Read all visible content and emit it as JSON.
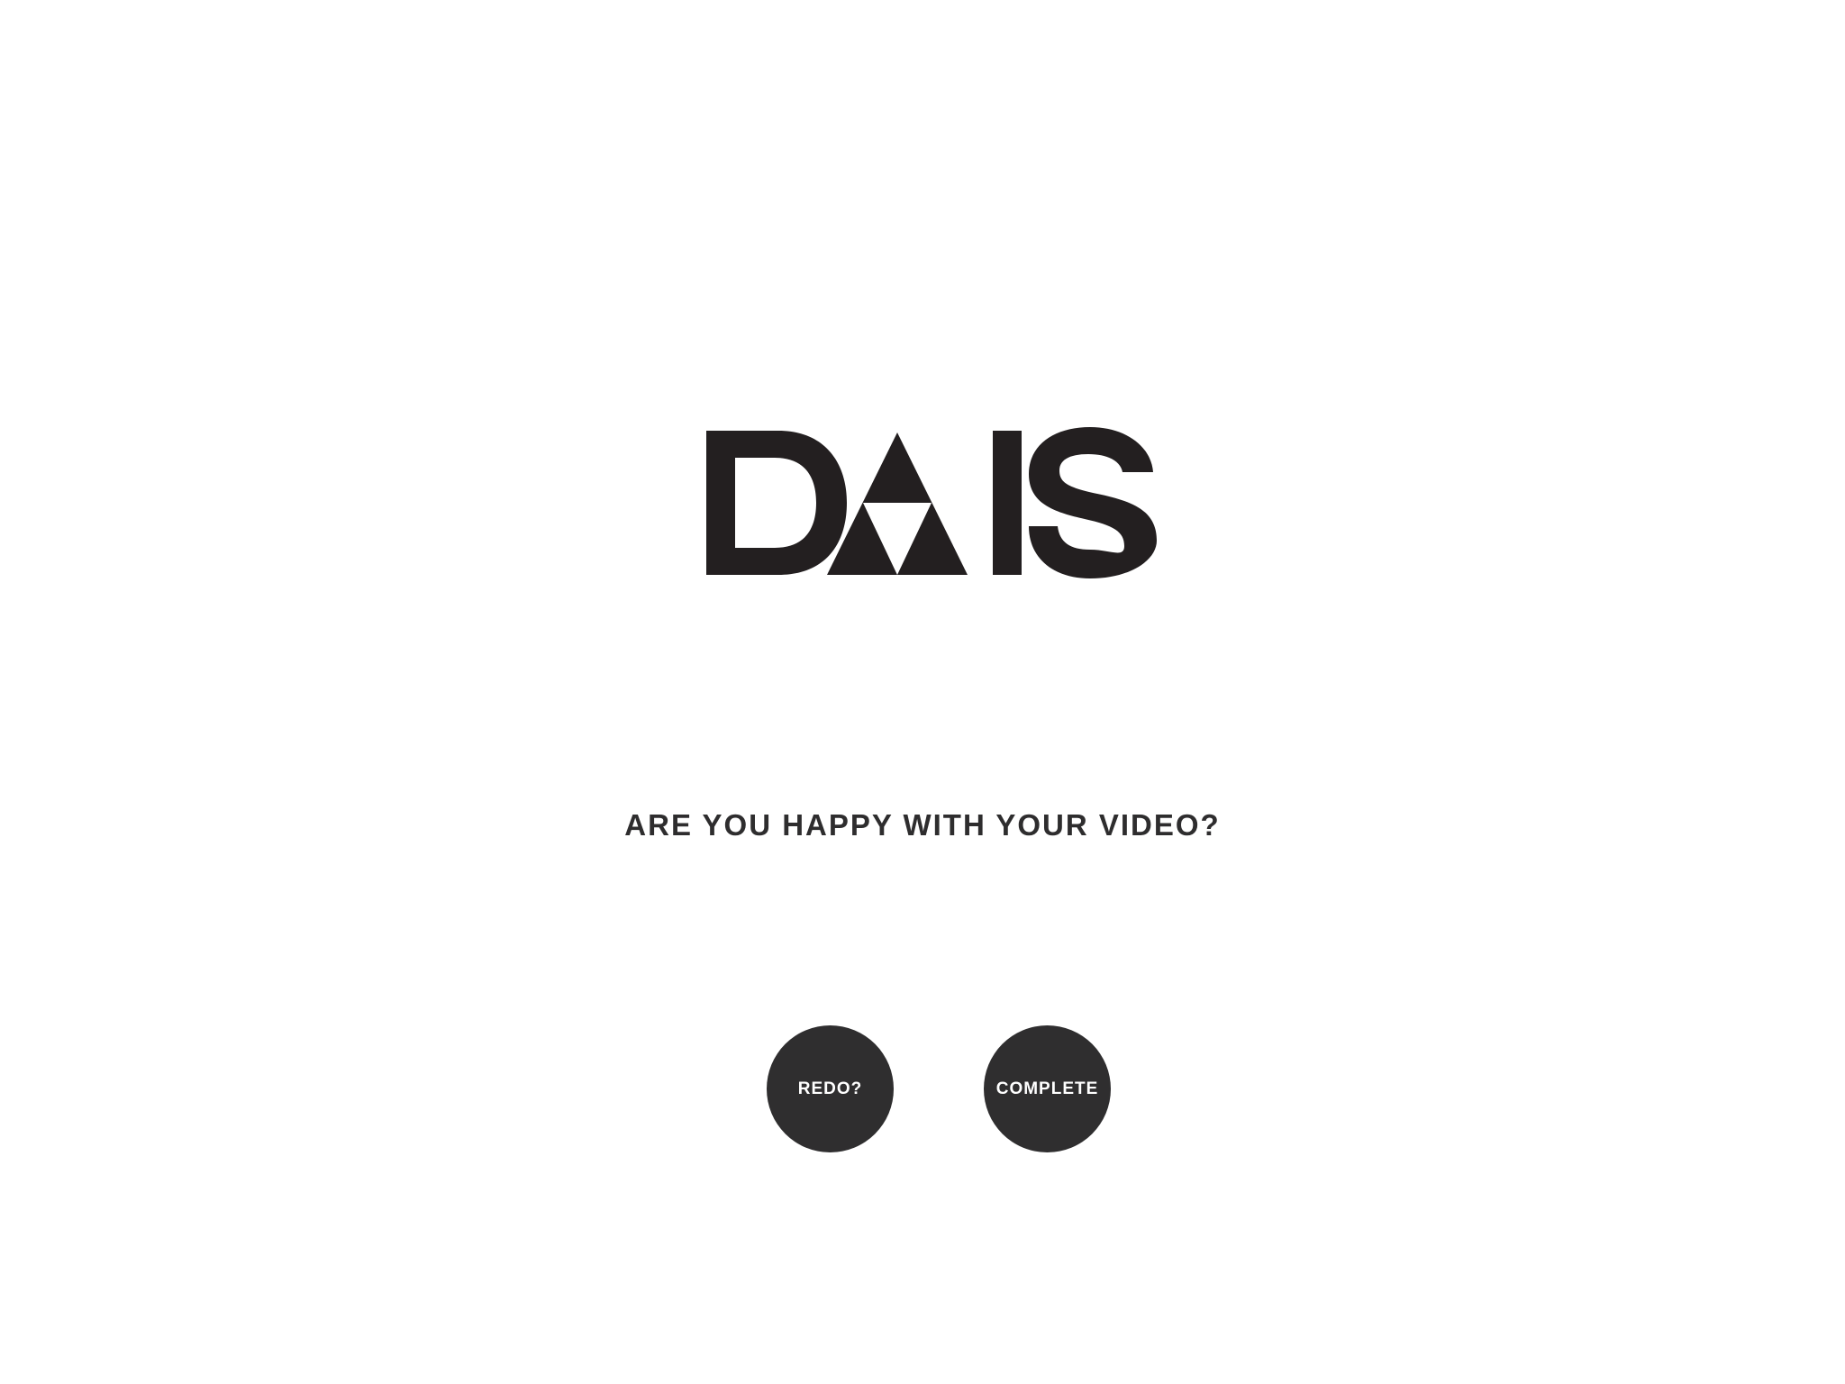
{
  "logo": {
    "text": "DAIS",
    "color": "#231f20"
  },
  "prompt": {
    "question": "ARE YOU HAPPY WITH YOUR VIDEO?"
  },
  "actions": {
    "redo_label": "REDO?",
    "complete_label": "COMPLETE",
    "button_color": "#2f2e2f",
    "button_text_color": "#ffffff"
  }
}
